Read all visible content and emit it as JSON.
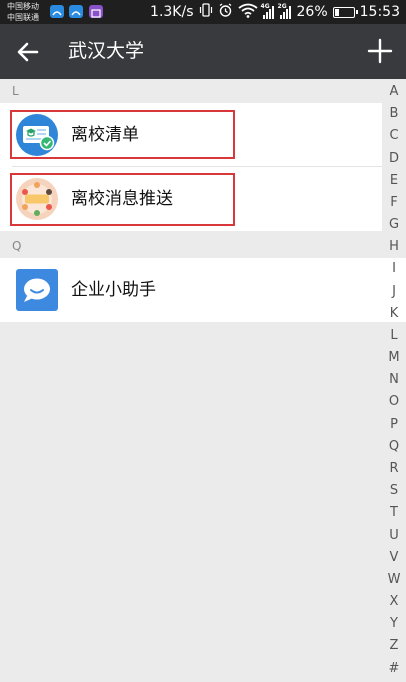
{
  "status_bar": {
    "carrier_1": "中国移动",
    "carrier_2": "中国联通",
    "network_speed": "1.3K/s",
    "sig1_tag": "4G",
    "sig2_tag": "2G",
    "battery": "26%",
    "battery_level": 0.26,
    "time": "15:53",
    "app_icons": [
      "app-icon-blue-1",
      "app-icon-blue-2",
      "app-icon-purple"
    ]
  },
  "header": {
    "title": "武汉大学",
    "back_icon": "arrow-left-icon",
    "add_icon": "plus-icon"
  },
  "sections": [
    {
      "letter": "L",
      "items": [
        {
          "label": "离校清单",
          "icon": "certificate-checklist-icon",
          "highlighted": true
        },
        {
          "label": "离校消息推送",
          "icon": "new-message-badge-icon",
          "highlighted": true
        }
      ]
    },
    {
      "letter": "Q",
      "items": [
        {
          "label": "企业小助手",
          "icon": "chat-bubble-icon",
          "highlighted": false
        }
      ]
    }
  ],
  "alphabet_index": [
    "A",
    "B",
    "C",
    "D",
    "E",
    "F",
    "G",
    "H",
    "I",
    "J",
    "K",
    "L",
    "M",
    "N",
    "O",
    "P",
    "Q",
    "R",
    "S",
    "T",
    "U",
    "V",
    "W",
    "X",
    "Y",
    "Z",
    "#"
  ],
  "colors": {
    "status_bar_bg": "#1f1f1f",
    "title_bar_bg": "#393a3e",
    "highlight_border": "#d9383a",
    "chat_icon_bg": "#3d89e0"
  }
}
